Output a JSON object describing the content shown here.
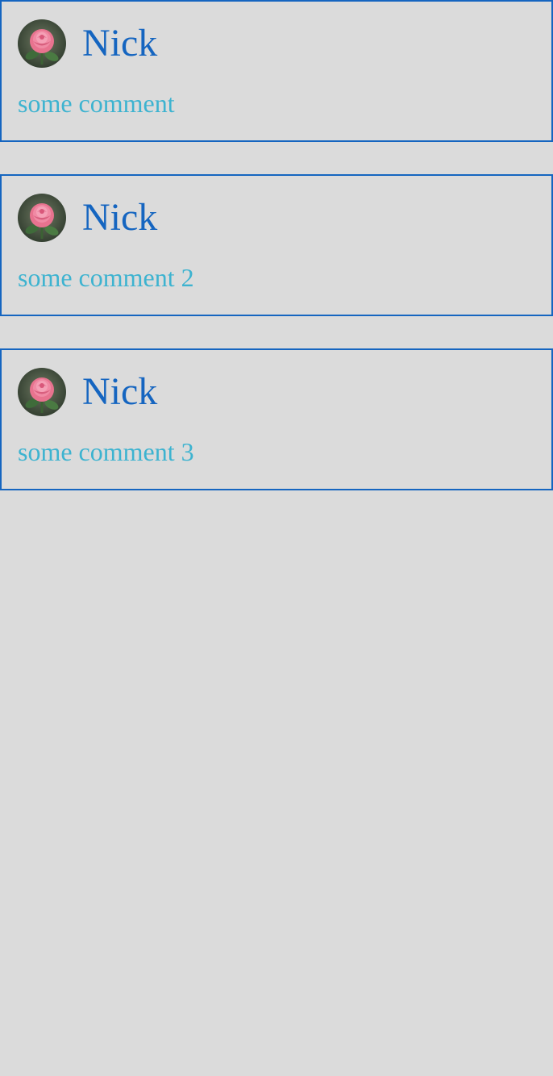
{
  "comments": [
    {
      "author": "Nick",
      "avatar_icon": "rose-avatar",
      "text": "some comment"
    },
    {
      "author": "Nick",
      "avatar_icon": "rose-avatar",
      "text": "some comment 2"
    },
    {
      "author": "Nick",
      "avatar_icon": "rose-avatar",
      "text": "some comment 3"
    }
  ],
  "colors": {
    "background": "#dbdbdb",
    "card_border": "#1565c0",
    "author_name": "#1565c0",
    "comment_text": "#3db3d0"
  }
}
